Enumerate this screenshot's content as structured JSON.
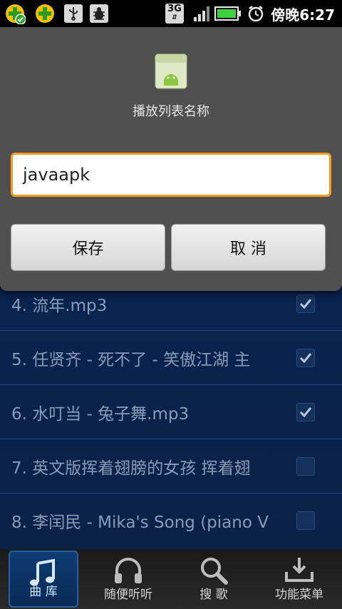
{
  "status_bar": {
    "time": "傍晚6:27",
    "network": "3G",
    "icons": [
      "app-plus-check-icon",
      "app-plus-icon",
      "usb-icon",
      "debug-bug-icon",
      "network-3g-icon",
      "signal-icon",
      "battery-icon",
      "alarm-icon"
    ]
  },
  "dialog": {
    "title": "播放列表名称",
    "input_value": "javaapk",
    "save_label": "保存",
    "cancel_label": "取 消"
  },
  "list": {
    "items": [
      {
        "text": "4.  流年.mp3",
        "checked": true
      },
      {
        "text": "5.  任贤齐 - 死不了 - 笑傲江湖 主",
        "checked": true
      },
      {
        "text": "6.  水叮当 - 兔子舞.mp3",
        "checked": true
      },
      {
        "text": "7.  英文版挥着翅膀的女孩 挥着翅",
        "checked": false
      },
      {
        "text": "8.  李闰民 - Mika's Song (piano V",
        "checked": false
      }
    ]
  },
  "tabs": [
    {
      "label": "曲 库",
      "icon": "music-note-icon",
      "active": true
    },
    {
      "label": "随便听听",
      "icon": "headphones-icon",
      "active": false
    },
    {
      "label": "搜 歌",
      "icon": "search-icon",
      "active": false
    },
    {
      "label": "功能菜单",
      "icon": "download-tray-icon",
      "active": false
    }
  ]
}
